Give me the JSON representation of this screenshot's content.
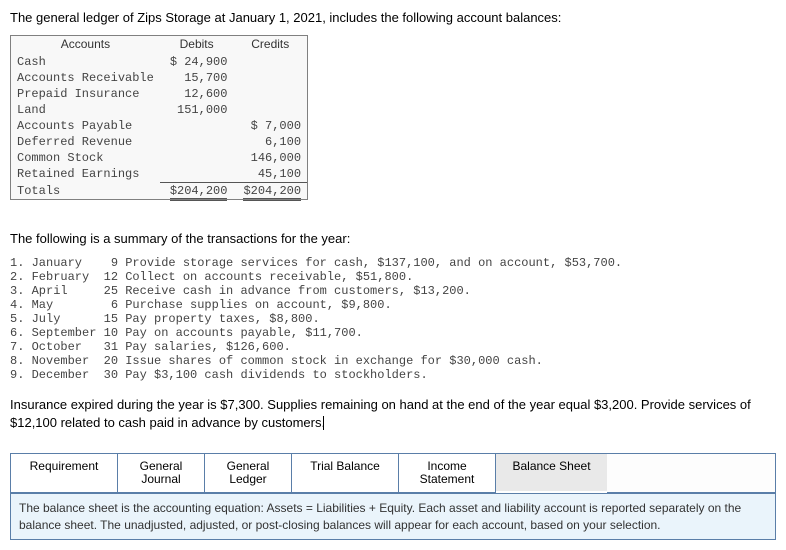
{
  "intro": "The general ledger of Zips Storage at January 1, 2021, includes the following account balances:",
  "ledger": {
    "headers": {
      "accounts": "Accounts",
      "debits": "Debits",
      "credits": "Credits"
    },
    "rows": [
      {
        "name": "Cash",
        "debit": "$ 24,900",
        "credit": ""
      },
      {
        "name": "Accounts Receivable",
        "debit": "15,700",
        "credit": ""
      },
      {
        "name": "Prepaid Insurance",
        "debit": "12,600",
        "credit": ""
      },
      {
        "name": "Land",
        "debit": "151,000",
        "credit": ""
      },
      {
        "name": "Accounts Payable",
        "debit": "",
        "credit": "$  7,000"
      },
      {
        "name": "Deferred Revenue",
        "debit": "",
        "credit": "6,100"
      },
      {
        "name": "Common Stock",
        "debit": "",
        "credit": "146,000"
      },
      {
        "name": "Retained Earnings",
        "debit": "",
        "credit": "45,100"
      }
    ],
    "totals": {
      "name": "Totals",
      "debit": "$204,200",
      "credit": "$204,200"
    }
  },
  "summary_header": "The following is a summary of the transactions for the year:",
  "tx": [
    "1. January    9 Provide storage services for cash, $137,100, and on account, $53,700.",
    "2. February  12 Collect on accounts receivable, $51,800.",
    "3. April     25 Receive cash in advance from customers, $13,200.",
    "4. May        6 Purchase supplies on account, $9,800.",
    "5. July      15 Pay property taxes, $8,800.",
    "6. September 10 Pay on accounts payable, $11,700.",
    "7. October   31 Pay salaries, $126,600.",
    "8. November  20 Issue shares of common stock in exchange for $30,000 cash.",
    "9. December  30 Pay $3,100 cash dividends to stockholders."
  ],
  "footer": "Insurance expired during the year is $7,300. Supplies remaining on hand at the end of the year equal $3,200. Provide services of $12,100 related to cash paid in advance by customers.",
  "tabs": {
    "requirement": "Requirement",
    "gj": "General\nJournal",
    "gl": "General\nLedger",
    "tb": "Trial Balance",
    "is": "Income\nStatement",
    "bs": "Balance Sheet"
  },
  "info": "The balance sheet is the accounting equation: Assets = Liabilities + Equity. Each asset and liability account is reported separately on the balance sheet. The unadjusted, adjusted, or post-closing balances will appear for each account, based on your selection."
}
